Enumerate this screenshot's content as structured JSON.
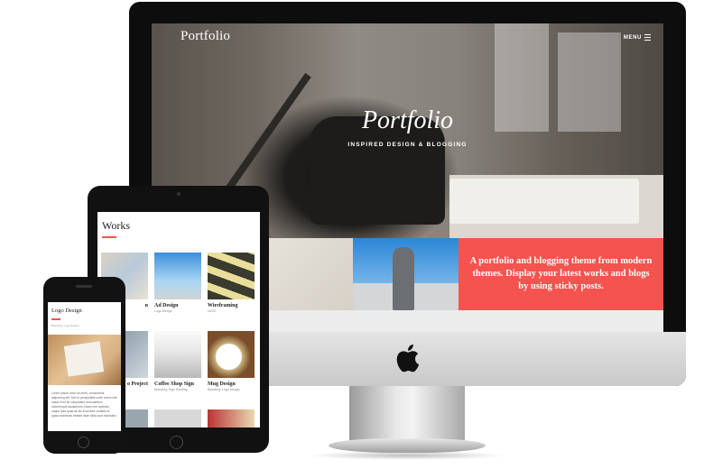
{
  "desktop": {
    "brand": "Portfolio",
    "menu_label": "MENU",
    "hero_title": "Portfolio",
    "hero_subtitle": "INSPIRED DESIGN & BLOGGING",
    "promo_text": "A portfolio and blogging theme from modern themes. Display your latest works and blogs by using sticky posts.",
    "accent_color": "#f5534f"
  },
  "tablet": {
    "section_title": "Works",
    "cards": [
      {
        "title": "Ad Design",
        "subtitle": "Logo Design"
      },
      {
        "title": "Wireframing",
        "subtitle": "UI/UX"
      },
      {
        "title": "Coffee Shop Sign",
        "subtitle": "Branding, Sign Painting"
      },
      {
        "title": "Mug Design",
        "subtitle": "Branding, Logo Design"
      }
    ],
    "partial_titles": [
      "n",
      "o Project"
    ]
  },
  "phone": {
    "title": "Logo Design",
    "subtitle": "Branding, Logo Design",
    "body_text": "Lorem ipsum dolor sit amet, consectetur adipiscing elit. Sed ut perspiciatis unde omnis iste natus error sit voluptatem accusantium doloremque laudantium, totam rem aperiam, eaque ipsa quae ab illo inventore veritatis et quasi architecto beatae vitae dicta sunt explicabo."
  }
}
